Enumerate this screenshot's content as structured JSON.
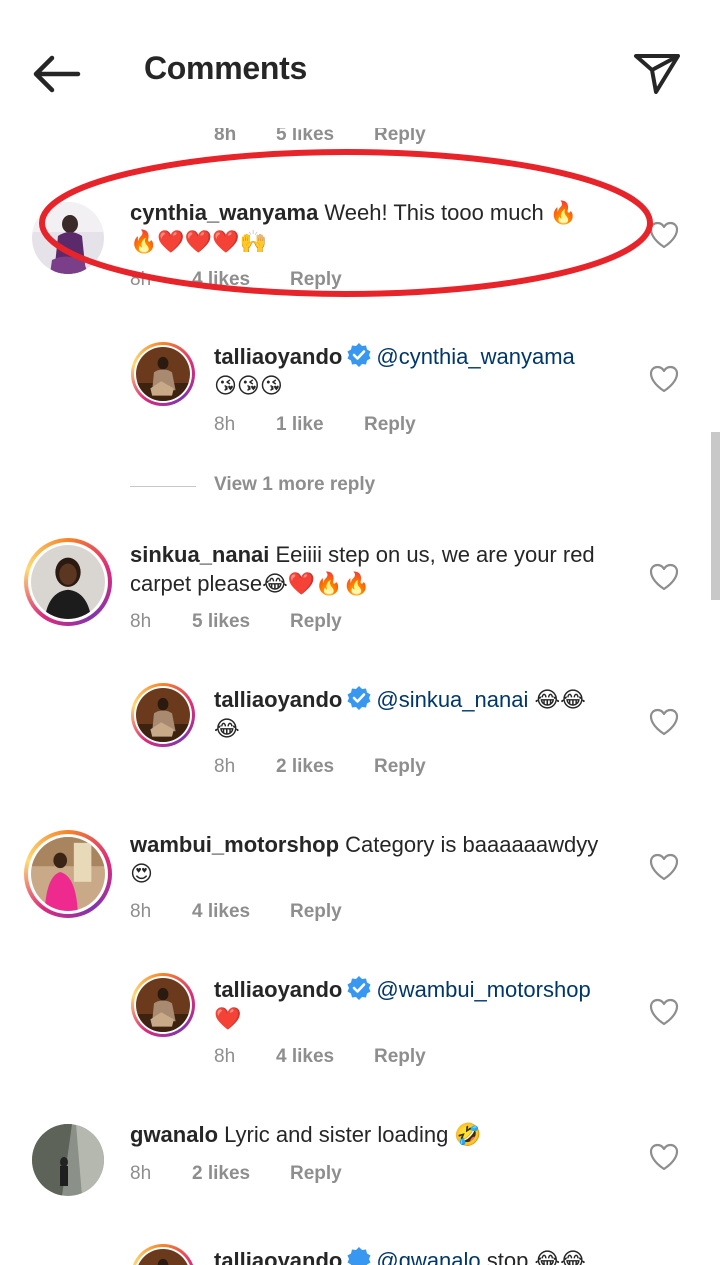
{
  "header": {
    "title": "Comments"
  },
  "partial_meta": {
    "time": "8h",
    "likes": "5 likes",
    "reply": "Reply"
  },
  "comments": [
    {
      "username": "cynthia_wanyama",
      "text": " Weeh! This tooo much 🔥",
      "text2": "🔥❤️❤️❤️🙌",
      "time": "8h",
      "likes": "4 likes",
      "reply": "Reply"
    },
    {
      "username": "talliaoyando",
      "mention": "@cynthia_wanyama",
      "text2": "😘😘😘",
      "time": "8h",
      "likes": "1 like",
      "reply": "Reply"
    },
    {
      "username": "sinkua_nanai",
      "text": " Eeiiii step on us, we are your red",
      "text2": "carpet please😂❤️🔥🔥",
      "time": "8h",
      "likes": "5 likes",
      "reply": "Reply"
    },
    {
      "username": "talliaoyando",
      "mention": "@sinkua_nanai",
      "text": " 😂😂",
      "text2": "😂",
      "time": "8h",
      "likes": "2 likes",
      "reply": "Reply"
    },
    {
      "username": "wambui_motorshop",
      "text": " Category is baaaaaawdyy",
      "text2": "😍",
      "time": "8h",
      "likes": "4 likes",
      "reply": "Reply"
    },
    {
      "username": "talliaoyando",
      "mention": "@wambui_motorshop",
      "text2": "❤️",
      "time": "8h",
      "likes": "4 likes",
      "reply": "Reply"
    },
    {
      "username": "gwanalo",
      "text": " Lyric and sister loading 🤣",
      "time": "8h",
      "likes": "2 likes",
      "reply": "Reply"
    },
    {
      "username": "talliaoyando",
      "mention": "@gwanalo",
      "text": " stop 😂😂"
    }
  ],
  "view_more": "View 1 more reply",
  "icons": {
    "back": "arrow-left-icon",
    "send": "paper-plane-icon",
    "like": "heart-outline-icon",
    "verified": "verified-badge-icon"
  },
  "colors": {
    "verified": "#3897f0",
    "mention": "#00376b",
    "meta": "#8e8e8e",
    "highlight": "#e8242b"
  }
}
